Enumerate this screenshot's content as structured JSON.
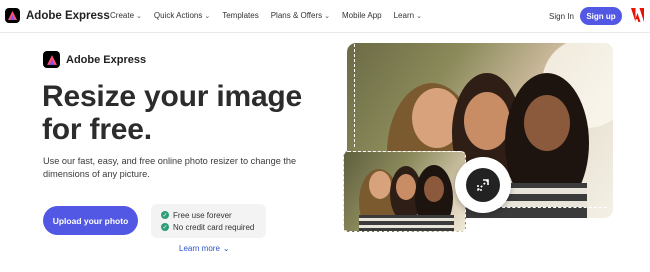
{
  "nav": {
    "brand": "Adobe Express",
    "menu": [
      {
        "label": "Create",
        "has_dropdown": true
      },
      {
        "label": "Quick Actions",
        "has_dropdown": true
      },
      {
        "label": "Templates",
        "has_dropdown": false
      },
      {
        "label": "Plans & Offers",
        "has_dropdown": true
      },
      {
        "label": "Mobile App",
        "has_dropdown": false
      },
      {
        "label": "Learn",
        "has_dropdown": true
      }
    ],
    "sign_in": "Sign In",
    "sign_up": "Sign up"
  },
  "hero": {
    "brand": "Adobe Express",
    "headline": "Resize your image for free.",
    "description": "Use our fast, easy, and free online photo resizer to change the dimensions of any picture.",
    "cta": "Upload your photo",
    "features": [
      "Free use forever",
      "No credit card required"
    ],
    "learn_more": "Learn more"
  },
  "colors": {
    "accent": "#5258e4",
    "check": "#2d9d78",
    "adobe_red": "#eb1000",
    "link": "#2c52c9"
  },
  "icons": {
    "chevron": "chevron-down-icon",
    "check": "checkmark-icon",
    "resize": "resize-arrows-icon"
  }
}
